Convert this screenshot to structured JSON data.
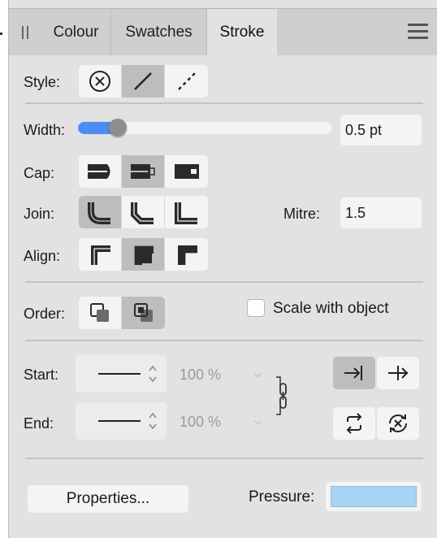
{
  "tabs": [
    {
      "label": "Colour",
      "active": false
    },
    {
      "label": "Swatches",
      "active": false
    },
    {
      "label": "Stroke",
      "active": true
    }
  ],
  "style": {
    "label": "Style:",
    "options": [
      "none-style-icon",
      "solid-line-icon",
      "dashed-line-icon"
    ],
    "selected": 1
  },
  "width": {
    "label": "Width:",
    "value": "0.5 pt",
    "slider_fraction": 0.12,
    "accent": "#4a8ef1"
  },
  "cap": {
    "label": "Cap:",
    "options": [
      "butt-cap-icon",
      "round-cap-icon",
      "square-cap-icon"
    ],
    "selected": 1
  },
  "join": {
    "label": "Join:",
    "options": [
      "round-join-icon",
      "bevel-join-icon",
      "mitre-join-icon"
    ],
    "selected": 0
  },
  "mitre": {
    "label": "Mitre:",
    "value": "1.5"
  },
  "align": {
    "label": "Align:",
    "options": [
      "align-center-icon",
      "align-inside-icon",
      "align-outside-icon"
    ],
    "selected": 1
  },
  "order": {
    "label": "Order:",
    "options": [
      "stroke-behind-icon",
      "stroke-front-icon"
    ],
    "selected": 1
  },
  "scale_with_object": {
    "label": "Scale with object",
    "checked": false
  },
  "start": {
    "label": "Start:",
    "percent": "100 %"
  },
  "end": {
    "label": "End:",
    "percent": "100 %"
  },
  "properties_button": "Properties...",
  "pressure": {
    "label": "Pressure:",
    "color": "#a7d3f5"
  }
}
